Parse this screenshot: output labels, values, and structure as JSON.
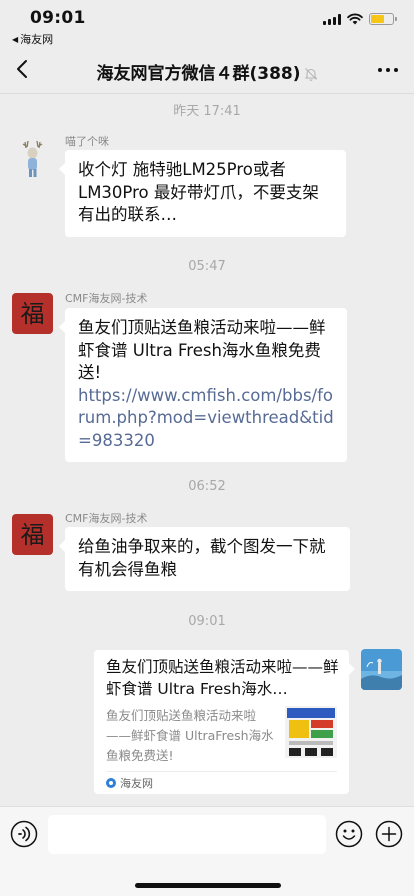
{
  "status_bar": {
    "time": "09:01",
    "back_app_label": "海友网"
  },
  "nav": {
    "title": "海友网官方微信４群(388)"
  },
  "messages": [
    {
      "type": "timestamp",
      "text": "昨天 17:41"
    },
    {
      "type": "text",
      "sender": "喵了个咪",
      "text": "收个灯 施特驰LM25Pro或者LM30Pro 最好带灯爪，不要支架有出的联系…"
    },
    {
      "type": "timestamp",
      "text": "05:47"
    },
    {
      "type": "text",
      "sender": "CMF海友网-技术",
      "text": "鱼友们顶贴送鱼粮活动来啦——鲜虾食谱 Ultra Fresh海水鱼粮免费送!",
      "link": "https://www.cmfish.com/bbs/forum.php?mod=viewthread&tid=983320"
    },
    {
      "type": "timestamp",
      "text": "06:52"
    },
    {
      "type": "text",
      "sender": "CMF海友网-技术",
      "text": "给鱼油争取来的，截个图发一下就有机会得鱼粮"
    },
    {
      "type": "timestamp",
      "text": "09:01"
    },
    {
      "type": "card",
      "from_self": true,
      "title": "鱼友们顶贴送鱼粮活动来啦——鲜虾食谱 Ultra Fresh海水…",
      "description": "鱼友们顶贴送鱼粮活动来啦——鲜虾食谱 UltraFresh海水鱼粮免费送!",
      "source": "海友网"
    }
  ],
  "colors": {
    "background": "#ededed",
    "bubble": "#ffffff",
    "link": "#576b95",
    "avatar_fu": "#b5302a",
    "battery": "#f5c518"
  },
  "icons": [
    "signal-icon",
    "wifi-icon",
    "battery-icon",
    "back-chevron-icon",
    "mute-icon",
    "more-icon",
    "voice-icon",
    "emoji-icon",
    "plus-icon"
  ]
}
